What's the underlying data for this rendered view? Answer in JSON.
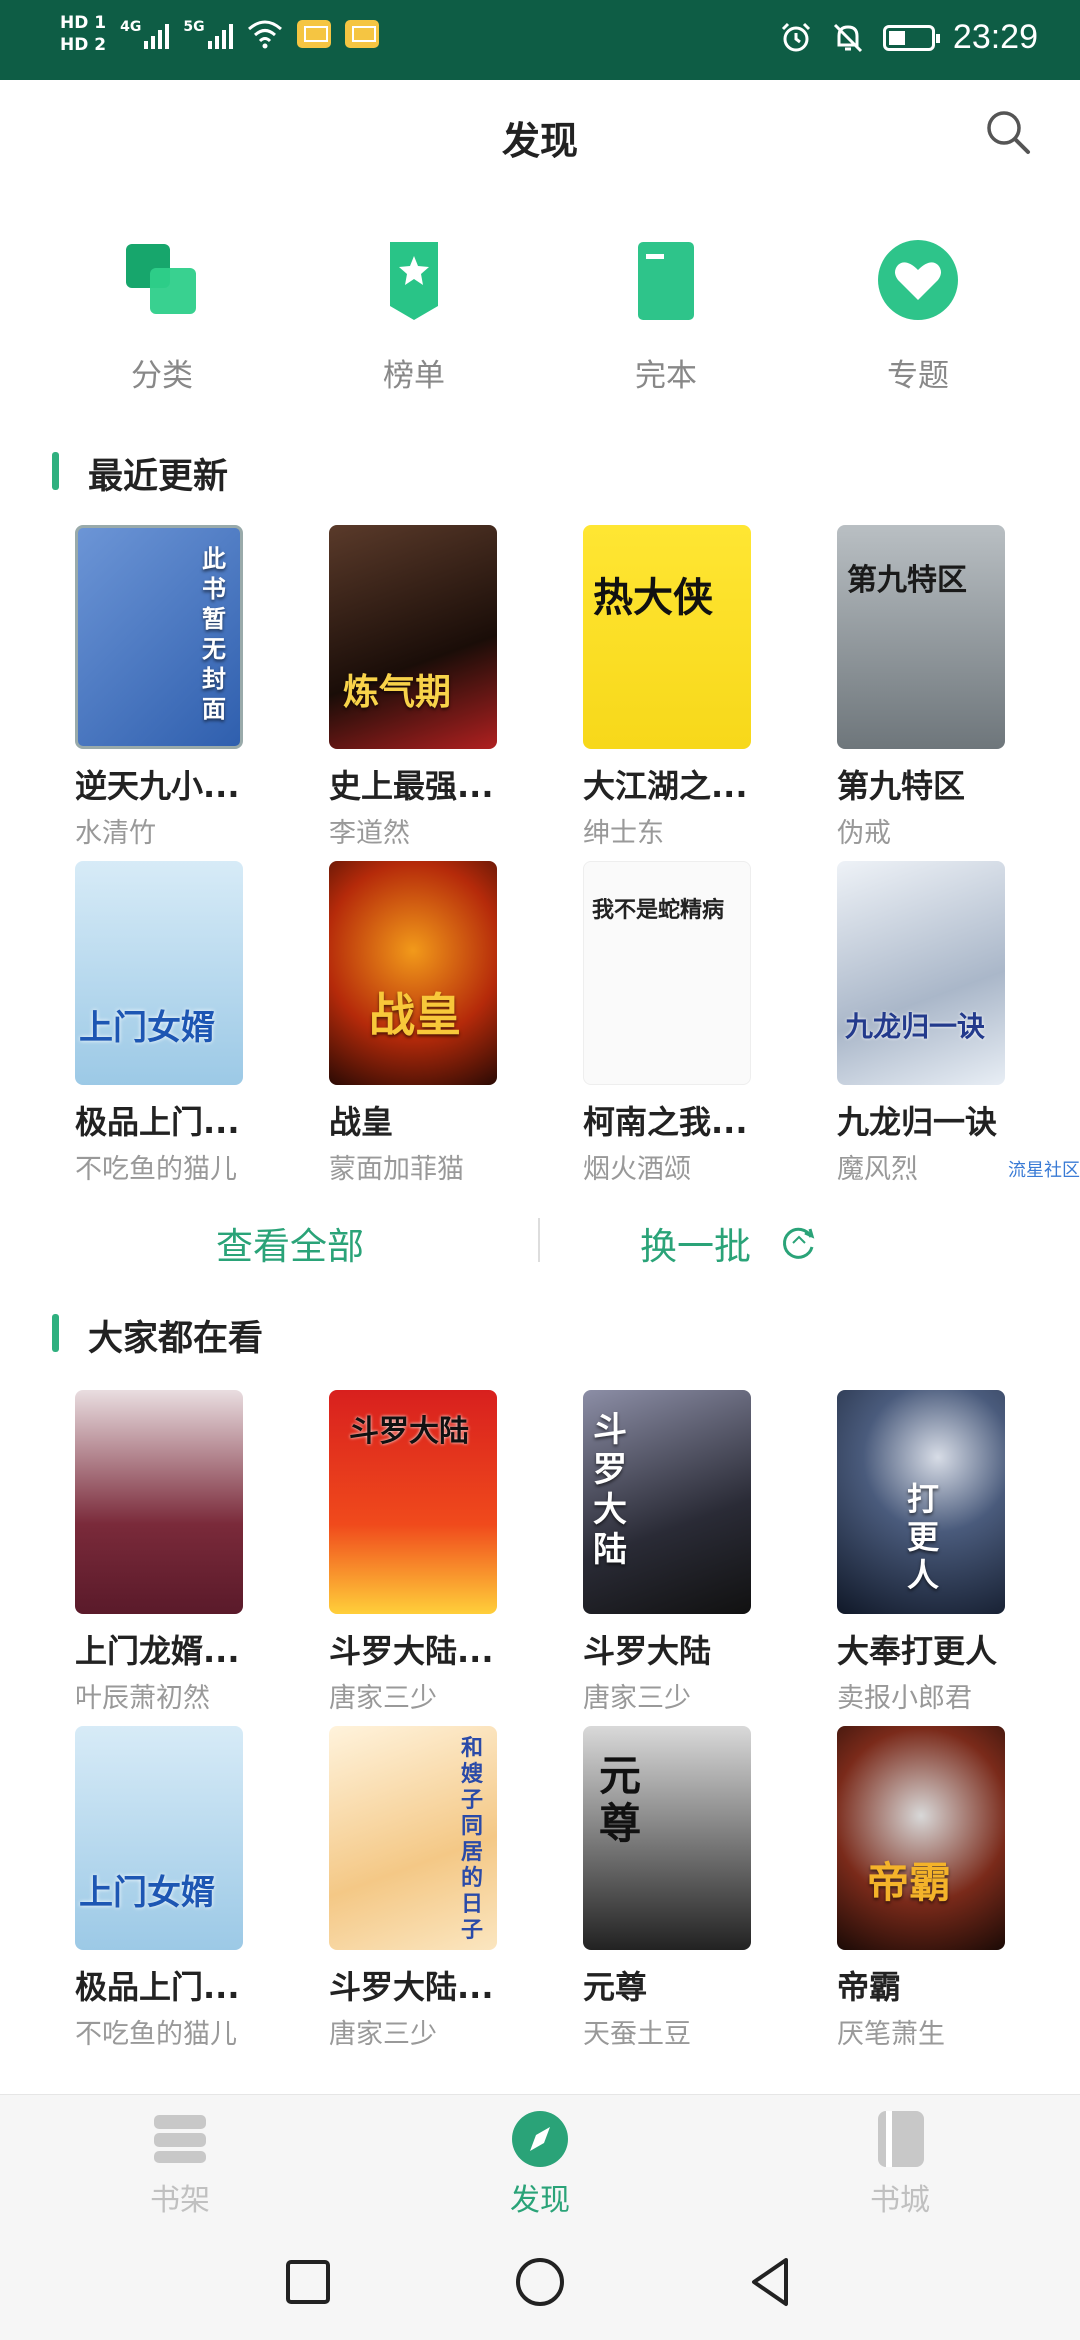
{
  "status_bar": {
    "hd1": "HD 1",
    "hd2": "HD 2",
    "net1": "4G",
    "net2": "5G",
    "time": "23:29"
  },
  "header": {
    "title": "发现",
    "search_icon": "search-icon"
  },
  "quick_nav": [
    {
      "label": "分类",
      "icon": "category-icon",
      "color": "#1fbf7b"
    },
    {
      "label": "榜单",
      "icon": "ranking-icon",
      "color": "#29c487"
    },
    {
      "label": "完本",
      "icon": "completed-book-icon",
      "color": "#2ec48a"
    },
    {
      "label": "专题",
      "icon": "heart-icon",
      "color": "#2ec48a"
    }
  ],
  "recent_updates": {
    "title": "最近更新",
    "books": [
      {
        "title": "逆天九小...",
        "author": "水清竹",
        "cover_text": "此书暂无封面"
      },
      {
        "title": "史上最强...",
        "author": "李道然",
        "cover_text": "炼气期"
      },
      {
        "title": "大江湖之...",
        "author": "绅士东",
        "cover_text": "热大侠"
      },
      {
        "title": "第九特区",
        "author": "伪戒",
        "cover_text": "第九特区"
      },
      {
        "title": "极品上门...",
        "author": "不吃鱼的猫儿",
        "cover_text": "上门女婿"
      },
      {
        "title": "战皇",
        "author": "蒙面加菲猫",
        "cover_text": "战皇"
      },
      {
        "title": "柯南之我...",
        "author": "烟火酒颂",
        "cover_text": "我不是蛇精病"
      },
      {
        "title": "九龙归一诀",
        "author": "魔风烈",
        "cover_text": "九龙归一诀"
      }
    ]
  },
  "actions": {
    "view_all": "查看全部",
    "refresh": "换一批"
  },
  "side_tag": "流星社区",
  "popular": {
    "title": "大家都在看",
    "books": [
      {
        "title": "上门龙婿...",
        "author": "叶辰萧初然",
        "cover_text": ""
      },
      {
        "title": "斗罗大陆...",
        "author": "唐家三少",
        "cover_text": "斗罗大陆"
      },
      {
        "title": "斗罗大陆",
        "author": "唐家三少",
        "cover_text": "斗罗大陆"
      },
      {
        "title": "大奉打更人",
        "author": "卖报小郎君",
        "cover_text": "打更人"
      },
      {
        "title": "极品上门...",
        "author": "不吃鱼的猫儿",
        "cover_text": "上门女婿"
      },
      {
        "title": "斗罗大陆...",
        "author": "唐家三少",
        "cover_text": "和嫂子同居的日子"
      },
      {
        "title": "元尊",
        "author": "天蚕土豆",
        "cover_text": "元尊"
      },
      {
        "title": "帝霸",
        "author": "厌笔萧生",
        "cover_text": "帝霸"
      }
    ]
  },
  "bottom_nav": [
    {
      "label": "书架",
      "icon": "bookshelf-icon"
    },
    {
      "label": "发现",
      "icon": "compass-icon"
    },
    {
      "label": "书城",
      "icon": "bookstore-icon"
    }
  ],
  "colors": {
    "accent": "#2aa378",
    "status_bar": "#0e5d45"
  }
}
